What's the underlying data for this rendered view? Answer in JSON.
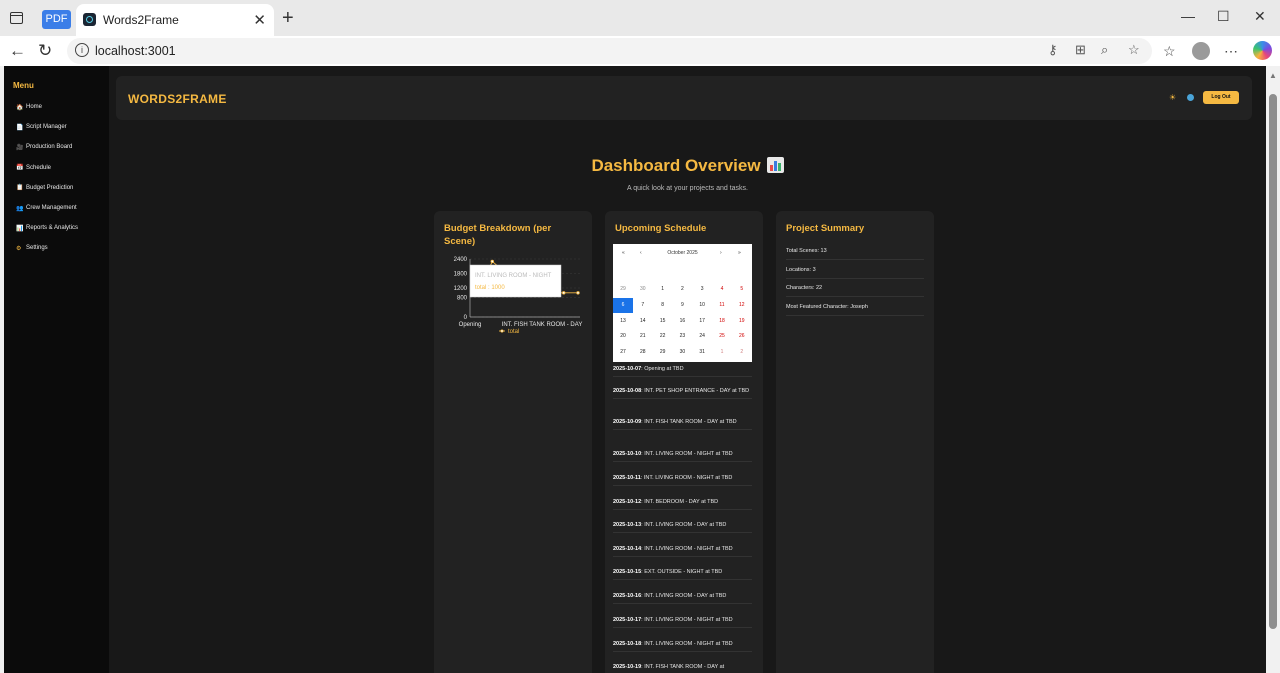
{
  "browser": {
    "pdf_tab": "PDF",
    "tab_title": "Words2Frame",
    "url": "localhost:3001"
  },
  "sidebar": {
    "title": "Menu",
    "items": [
      {
        "label": "Home",
        "icon": "home-icon"
      },
      {
        "label": "Script Manager",
        "icon": "document-icon"
      },
      {
        "label": "Production Board",
        "icon": "camera-icon"
      },
      {
        "label": "Schedule",
        "icon": "calendar-icon"
      },
      {
        "label": "Budget Prediction",
        "icon": "clipboard-icon"
      },
      {
        "label": "Crew Management",
        "icon": "crew-icon"
      },
      {
        "label": "Reports & Analytics",
        "icon": "bar-chart-icon"
      },
      {
        "label": "Settings",
        "icon": "gear-icon"
      }
    ]
  },
  "header": {
    "brand": "WORDS2FRAME",
    "logout_label": "Log Out"
  },
  "dashboard": {
    "title": "Dashboard Overview",
    "subtitle": "A quick look at your projects and tasks."
  },
  "budget": {
    "title": "Budget Breakdown (per Scene)",
    "tooltip_title": "INT. LIVING ROOM - NIGHT",
    "tooltip_value": "total : 1000",
    "legend": "total"
  },
  "chart_data": {
    "type": "line",
    "title": "Budget Breakdown (per Scene)",
    "x_tick_labels": [
      "Opening",
      "INT. FISH TANK ROOM - DAY"
    ],
    "y_ticks": [
      0,
      800,
      1200,
      1800,
      2400
    ],
    "ylim": [
      0,
      2400
    ],
    "series": [
      {
        "name": "total",
        "color": "#f5b942",
        "values": [
          1000,
          2300,
          1800,
          1000,
          1000,
          1000,
          1000,
          1000
        ]
      }
    ],
    "legend_placement": "bottom",
    "grid": true
  },
  "schedule": {
    "title": "Upcoming Schedule",
    "month_label": "October 2025",
    "nav": [
      "«",
      "‹",
      "›",
      "»"
    ],
    "days": [
      {
        "d": "29",
        "c": "dim"
      },
      {
        "d": "30",
        "c": "dim"
      },
      {
        "d": "1",
        "c": ""
      },
      {
        "d": "2",
        "c": ""
      },
      {
        "d": "3",
        "c": ""
      },
      {
        "d": "4",
        "c": "wk"
      },
      {
        "d": "5",
        "c": "wk"
      },
      {
        "d": "6",
        "c": "today"
      },
      {
        "d": "7",
        "c": ""
      },
      {
        "d": "8",
        "c": ""
      },
      {
        "d": "9",
        "c": ""
      },
      {
        "d": "10",
        "c": ""
      },
      {
        "d": "11",
        "c": "wk"
      },
      {
        "d": "12",
        "c": "wk"
      },
      {
        "d": "13",
        "c": ""
      },
      {
        "d": "14",
        "c": ""
      },
      {
        "d": "15",
        "c": ""
      },
      {
        "d": "16",
        "c": ""
      },
      {
        "d": "17",
        "c": ""
      },
      {
        "d": "18",
        "c": "wk"
      },
      {
        "d": "19",
        "c": "wk"
      },
      {
        "d": "20",
        "c": ""
      },
      {
        "d": "21",
        "c": ""
      },
      {
        "d": "22",
        "c": ""
      },
      {
        "d": "23",
        "c": ""
      },
      {
        "d": "24",
        "c": ""
      },
      {
        "d": "25",
        "c": "wk"
      },
      {
        "d": "26",
        "c": "wk"
      },
      {
        "d": "27",
        "c": ""
      },
      {
        "d": "28",
        "c": ""
      },
      {
        "d": "29",
        "c": ""
      },
      {
        "d": "30",
        "c": ""
      },
      {
        "d": "31",
        "c": ""
      },
      {
        "d": "1",
        "c": "dimwk"
      },
      {
        "d": "2",
        "c": "dimwk"
      }
    ],
    "items": [
      {
        "date": "2025-10-07",
        "text": ": Opening at TBD"
      },
      {
        "date": "2025-10-08",
        "text": ": INT. PET SHOP ENTRANCE - DAY at TBD"
      },
      {
        "date": "2025-10-09",
        "text": ": INT. FISH TANK ROOM - DAY at TBD"
      },
      {
        "date": "2025-10-10",
        "text": ": INT. LIVING ROOM - NIGHT at TBD"
      },
      {
        "date": "2025-10-11",
        "text": ": INT. LIVING ROOM - NIGHT at TBD"
      },
      {
        "date": "2025-10-12",
        "text": ": INT. BEDROOM - DAY at TBD"
      },
      {
        "date": "2025-10-13",
        "text": ": INT. LIVING ROOM - DAY at TBD"
      },
      {
        "date": "2025-10-14",
        "text": ": INT. LIVING ROOM - NIGHT at TBD"
      },
      {
        "date": "2025-10-15",
        "text": ": EXT. OUTSIDE - NIGHT at TBD"
      },
      {
        "date": "2025-10-16",
        "text": ": INT. LIVING ROOM - DAY at TBD"
      },
      {
        "date": "2025-10-17",
        "text": ": INT. LIVING ROOM - NIGHT at TBD"
      },
      {
        "date": "2025-10-18",
        "text": ": INT. LIVING ROOM - NIGHT at TBD"
      },
      {
        "date": "2025-10-19",
        "text": ": INT. FISH TANK ROOM - DAY at"
      }
    ]
  },
  "summary": {
    "title": "Project Summary",
    "items": [
      "Total Scenes: 13",
      "Locations: 3",
      "Characters: 22",
      "Most Featured Character: Joseph"
    ]
  },
  "colors": {
    "accent": "#f5b942",
    "background": "#181818",
    "card": "#222222",
    "sidebar": "#0b0b0b"
  }
}
